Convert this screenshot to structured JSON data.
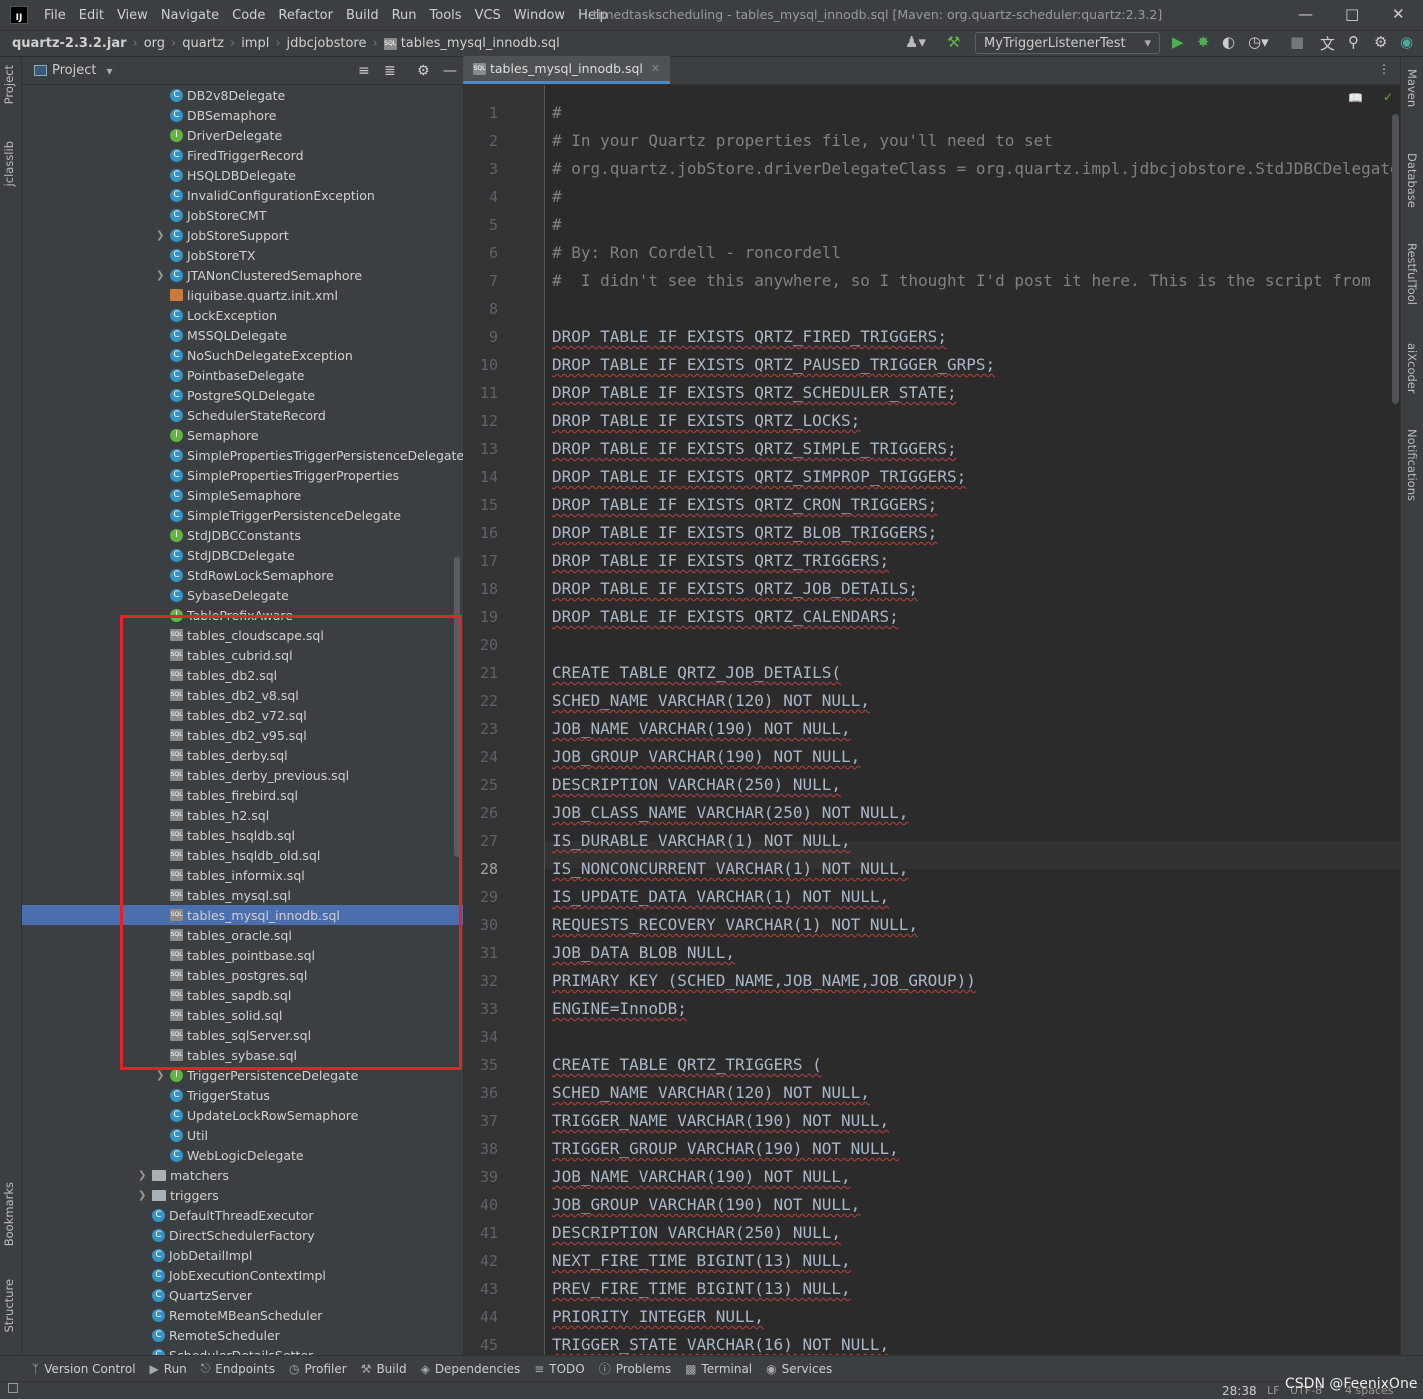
{
  "menubar": {
    "logo": "IJ",
    "items": [
      "File",
      "Edit",
      "View",
      "Navigate",
      "Code",
      "Refactor",
      "Build",
      "Run",
      "Tools",
      "VCS",
      "Window",
      "Help"
    ],
    "window_title": "timedtaskscheduling - tables_mysql_innodb.sql [Maven: org.quartz-scheduler:quartz:2.3.2]"
  },
  "breadcrumb": [
    "quartz-2.3.2.jar",
    "org",
    "quartz",
    "impl",
    "jdbcjobstore",
    "tables_mysql_innodb.sql"
  ],
  "run_config": "MyTriggerListenerTest",
  "left_strip": {
    "project": "Project",
    "jclasslib": "jclasslib",
    "bookmarks": "Bookmarks",
    "structure": "Structure"
  },
  "right_strip": {
    "maven": "Maven",
    "database": "Database",
    "restful": "RestfulTool",
    "aixcoder": "aiXcoder",
    "notifications": "Notifications"
  },
  "project_panel": {
    "title": "Project",
    "tree": [
      {
        "label": "DB2v8Delegate",
        "icon": "class"
      },
      {
        "label": "DBSemaphore",
        "icon": "class"
      },
      {
        "label": "DriverDelegate",
        "icon": "interface"
      },
      {
        "label": "FiredTriggerRecord",
        "icon": "class"
      },
      {
        "label": "HSQLDBDelegate",
        "icon": "class"
      },
      {
        "label": "InvalidConfigurationException",
        "icon": "class"
      },
      {
        "label": "JobStoreCMT",
        "icon": "class"
      },
      {
        "label": "JobStoreSupport",
        "icon": "class",
        "arrow": true
      },
      {
        "label": "JobStoreTX",
        "icon": "class"
      },
      {
        "label": "JTANonClusteredSemaphore",
        "icon": "class",
        "arrow": true
      },
      {
        "label": "liquibase.quartz.init.xml",
        "icon": "file"
      },
      {
        "label": "LockException",
        "icon": "class"
      },
      {
        "label": "MSSQLDelegate",
        "icon": "class"
      },
      {
        "label": "NoSuchDelegateException",
        "icon": "class"
      },
      {
        "label": "PointbaseDelegate",
        "icon": "class"
      },
      {
        "label": "PostgreSQLDelegate",
        "icon": "class"
      },
      {
        "label": "SchedulerStateRecord",
        "icon": "class"
      },
      {
        "label": "Semaphore",
        "icon": "interface"
      },
      {
        "label": "SimplePropertiesTriggerPersistenceDelegateSu",
        "icon": "class"
      },
      {
        "label": "SimplePropertiesTriggerProperties",
        "icon": "class"
      },
      {
        "label": "SimpleSemaphore",
        "icon": "class"
      },
      {
        "label": "SimpleTriggerPersistenceDelegate",
        "icon": "class"
      },
      {
        "label": "StdJDBCConstants",
        "icon": "interface"
      },
      {
        "label": "StdJDBCDelegate",
        "icon": "class"
      },
      {
        "label": "StdRowLockSemaphore",
        "icon": "class"
      },
      {
        "label": "SybaseDelegate",
        "icon": "class"
      },
      {
        "label": "TablePrefixAware",
        "icon": "interface"
      },
      {
        "label": "tables_cloudscape.sql",
        "icon": "sql"
      },
      {
        "label": "tables_cubrid.sql",
        "icon": "sql"
      },
      {
        "label": "tables_db2.sql",
        "icon": "sql"
      },
      {
        "label": "tables_db2_v8.sql",
        "icon": "sql"
      },
      {
        "label": "tables_db2_v72.sql",
        "icon": "sql"
      },
      {
        "label": "tables_db2_v95.sql",
        "icon": "sql"
      },
      {
        "label": "tables_derby.sql",
        "icon": "sql"
      },
      {
        "label": "tables_derby_previous.sql",
        "icon": "sql"
      },
      {
        "label": "tables_firebird.sql",
        "icon": "sql"
      },
      {
        "label": "tables_h2.sql",
        "icon": "sql"
      },
      {
        "label": "tables_hsqldb.sql",
        "icon": "sql"
      },
      {
        "label": "tables_hsqldb_old.sql",
        "icon": "sql"
      },
      {
        "label": "tables_informix.sql",
        "icon": "sql"
      },
      {
        "label": "tables_mysql.sql",
        "icon": "sql"
      },
      {
        "label": "tables_mysql_innodb.sql",
        "icon": "sql",
        "selected": true
      },
      {
        "label": "tables_oracle.sql",
        "icon": "sql"
      },
      {
        "label": "tables_pointbase.sql",
        "icon": "sql"
      },
      {
        "label": "tables_postgres.sql",
        "icon": "sql"
      },
      {
        "label": "tables_sapdb.sql",
        "icon": "sql"
      },
      {
        "label": "tables_solid.sql",
        "icon": "sql"
      },
      {
        "label": "tables_sqlServer.sql",
        "icon": "sql"
      },
      {
        "label": "tables_sybase.sql",
        "icon": "sql"
      },
      {
        "label": "TriggerPersistenceDelegate",
        "icon": "interface",
        "arrow": true
      },
      {
        "label": "TriggerStatus",
        "icon": "class"
      },
      {
        "label": "UpdateLockRowSemaphore",
        "icon": "class"
      },
      {
        "label": "Util",
        "icon": "class"
      },
      {
        "label": "WebLogicDelegate",
        "icon": "class"
      },
      {
        "label": "matchers",
        "icon": "folder",
        "arrow": true,
        "level": 0
      },
      {
        "label": "triggers",
        "icon": "folder",
        "arrow": true,
        "level": 0
      },
      {
        "label": "DefaultThreadExecutor",
        "icon": "class",
        "level": 0
      },
      {
        "label": "DirectSchedulerFactory",
        "icon": "class",
        "level": 0
      },
      {
        "label": "JobDetailImpl",
        "icon": "class",
        "level": 0
      },
      {
        "label": "JobExecutionContextImpl",
        "icon": "class",
        "level": 0
      },
      {
        "label": "QuartzServer",
        "icon": "class",
        "level": 0
      },
      {
        "label": "RemoteMBeanScheduler",
        "icon": "class",
        "level": 0
      },
      {
        "label": "RemoteScheduler",
        "icon": "class",
        "level": 0
      },
      {
        "label": "SchedulerDetailsSetter",
        "icon": "class",
        "level": 0
      }
    ]
  },
  "editor": {
    "tab": "tables_mysql_innodb.sql",
    "current_line": 28,
    "lines": [
      {
        "n": "1",
        "t": "#",
        "k": "cm"
      },
      {
        "n": "2",
        "t": "# In your Quartz properties file, you'll need to set",
        "k": "cm"
      },
      {
        "n": "3",
        "t": "# org.quartz.jobStore.driverDelegateClass = org.quartz.impl.jdbcjobstore.StdJDBCDelegate",
        "k": "cm"
      },
      {
        "n": "4",
        "t": "#",
        "k": "cm"
      },
      {
        "n": "5",
        "t": "#",
        "k": "cm"
      },
      {
        "n": "6",
        "t": "# By: Ron Cordell - roncordell",
        "k": "cm"
      },
      {
        "n": "7",
        "t": "#  I didn't see this anywhere, so I thought I'd post it here. This is the script from",
        "k": "cm"
      },
      {
        "n": "8",
        "t": "",
        "k": ""
      },
      {
        "n": "9",
        "t": "DROP TABLE IF EXISTS QRTZ_FIRED_TRIGGERS;",
        "k": "sql"
      },
      {
        "n": "10",
        "t": "DROP TABLE IF EXISTS QRTZ_PAUSED_TRIGGER_GRPS;",
        "k": "sql"
      },
      {
        "n": "11",
        "t": "DROP TABLE IF EXISTS QRTZ_SCHEDULER_STATE;",
        "k": "sql"
      },
      {
        "n": "12",
        "t": "DROP TABLE IF EXISTS QRTZ_LOCKS;",
        "k": "sql"
      },
      {
        "n": "13",
        "t": "DROP TABLE IF EXISTS QRTZ_SIMPLE_TRIGGERS;",
        "k": "sql"
      },
      {
        "n": "14",
        "t": "DROP TABLE IF EXISTS QRTZ_SIMPROP_TRIGGERS;",
        "k": "sql"
      },
      {
        "n": "15",
        "t": "DROP TABLE IF EXISTS QRTZ_CRON_TRIGGERS;",
        "k": "sql"
      },
      {
        "n": "16",
        "t": "DROP TABLE IF EXISTS QRTZ_BLOB_TRIGGERS;",
        "k": "sql"
      },
      {
        "n": "17",
        "t": "DROP TABLE IF EXISTS QRTZ_TRIGGERS;",
        "k": "sql"
      },
      {
        "n": "18",
        "t": "DROP TABLE IF EXISTS QRTZ_JOB_DETAILS;",
        "k": "sql"
      },
      {
        "n": "19",
        "t": "DROP TABLE IF EXISTS QRTZ_CALENDARS;",
        "k": "sql"
      },
      {
        "n": "20",
        "t": "",
        "k": ""
      },
      {
        "n": "21",
        "t": "CREATE TABLE QRTZ_JOB_DETAILS(",
        "k": "sql"
      },
      {
        "n": "22",
        "t": "SCHED_NAME VARCHAR(120) NOT NULL,",
        "k": "sql"
      },
      {
        "n": "23",
        "t": "JOB_NAME VARCHAR(190) NOT NULL,",
        "k": "sql"
      },
      {
        "n": "24",
        "t": "JOB_GROUP VARCHAR(190) NOT NULL,",
        "k": "sql"
      },
      {
        "n": "25",
        "t": "DESCRIPTION VARCHAR(250) NULL,",
        "k": "sql"
      },
      {
        "n": "26",
        "t": "JOB_CLASS_NAME VARCHAR(250) NOT NULL,",
        "k": "sql"
      },
      {
        "n": "27",
        "t": "IS_DURABLE VARCHAR(1) NOT NULL,",
        "k": "sql"
      },
      {
        "n": "28",
        "t": "IS_NONCONCURRENT VARCHAR(1) NOT NULL,",
        "k": "sql"
      },
      {
        "n": "29",
        "t": "IS_UPDATE_DATA VARCHAR(1) NOT NULL,",
        "k": "sql"
      },
      {
        "n": "30",
        "t": "REQUESTS_RECOVERY VARCHAR(1) NOT NULL,",
        "k": "sql"
      },
      {
        "n": "31",
        "t": "JOB_DATA BLOB NULL,",
        "k": "sql"
      },
      {
        "n": "32",
        "t": "PRIMARY KEY (SCHED_NAME,JOB_NAME,JOB_GROUP))",
        "k": "sql"
      },
      {
        "n": "33",
        "t": "ENGINE=InnoDB;",
        "k": "sql"
      },
      {
        "n": "34",
        "t": "",
        "k": ""
      },
      {
        "n": "35",
        "t": "CREATE TABLE QRTZ_TRIGGERS (",
        "k": "sql"
      },
      {
        "n": "36",
        "t": "SCHED_NAME VARCHAR(120) NOT NULL,",
        "k": "sql"
      },
      {
        "n": "37",
        "t": "TRIGGER_NAME VARCHAR(190) NOT NULL,",
        "k": "sql"
      },
      {
        "n": "38",
        "t": "TRIGGER_GROUP VARCHAR(190) NOT NULL,",
        "k": "sql"
      },
      {
        "n": "39",
        "t": "JOB_NAME VARCHAR(190) NOT NULL,",
        "k": "sql"
      },
      {
        "n": "40",
        "t": "JOB_GROUP VARCHAR(190) NOT NULL,",
        "k": "sql"
      },
      {
        "n": "41",
        "t": "DESCRIPTION VARCHAR(250) NULL,",
        "k": "sql"
      },
      {
        "n": "42",
        "t": "NEXT_FIRE_TIME BIGINT(13) NULL,",
        "k": "sql"
      },
      {
        "n": "43",
        "t": "PREV_FIRE_TIME BIGINT(13) NULL,",
        "k": "sql"
      },
      {
        "n": "44",
        "t": "PRIORITY INTEGER NULL,",
        "k": "sql"
      },
      {
        "n": "45",
        "t": "TRIGGER_STATE VARCHAR(16) NOT NULL,",
        "k": "sql"
      }
    ]
  },
  "bottom_tools": [
    "Version Control",
    "Run",
    "Endpoints",
    "Profiler",
    "Build",
    "Dependencies",
    "TODO",
    "Problems",
    "Terminal",
    "Services"
  ],
  "status": {
    "position": "28:38",
    "line_sep": "LF",
    "encoding": "UTF-8",
    "indent": "4 spaces",
    "watermark": "CSDN @FeenixOne"
  }
}
